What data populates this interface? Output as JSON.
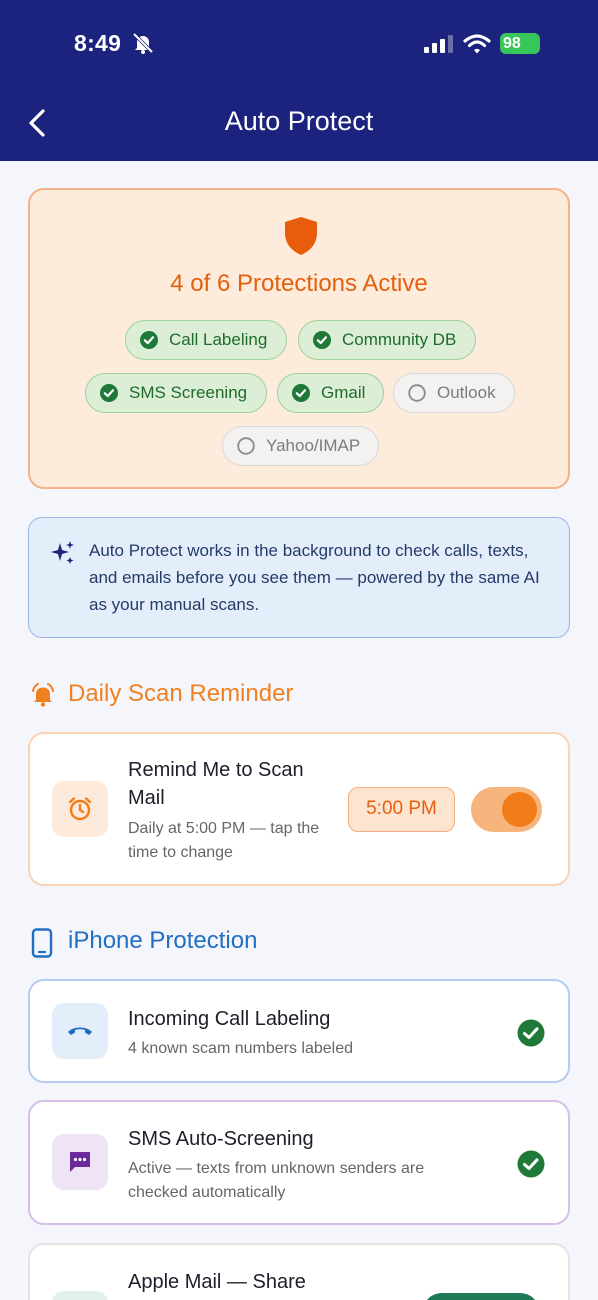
{
  "status_bar": {
    "time": "8:49",
    "battery": "98"
  },
  "header": {
    "title": "Auto Protect"
  },
  "protection_summary": {
    "title": "4 of 6 Protections Active",
    "active_count": 4,
    "total_count": 6,
    "chips": [
      {
        "label": "Call Labeling",
        "active": true
      },
      {
        "label": "Community DB",
        "active": true
      },
      {
        "label": "SMS Screening",
        "active": true
      },
      {
        "label": "Gmail",
        "active": true
      },
      {
        "label": "Outlook",
        "active": false
      },
      {
        "label": "Yahoo/IMAP",
        "active": false
      }
    ]
  },
  "info": {
    "text": "Auto Protect works in the background to check calls, texts, and emails before you see them — powered by the same AI as your manual scans."
  },
  "reminder_section": {
    "title": "Daily Scan Reminder",
    "card": {
      "title": "Remind Me to Scan Mail",
      "subtitle": "Daily at 5:00 PM — tap the time to change",
      "time": "5:00 PM",
      "enabled": true
    }
  },
  "iphone_section": {
    "title": "iPhone Protection",
    "items": [
      {
        "title": "Incoming Call Labeling",
        "subtitle": "4 known scam numbers labeled",
        "status": "active"
      },
      {
        "title": "SMS Auto-Screening",
        "subtitle": "Active — texts from unknown senders are checked automatically",
        "status": "active"
      },
      {
        "title": "Apple Mail — Share"
      }
    ]
  },
  "icons": [
    "bell-off-icon",
    "signal-icon",
    "wifi-icon",
    "battery-icon",
    "back-chevron-icon",
    "shield-icon",
    "check-circle-icon",
    "empty-circle-icon",
    "sparkle-icon",
    "bell-icon",
    "alarm-clock-icon",
    "phone-icon",
    "phone-handset-icon",
    "chat-bubble-icon"
  ],
  "colors": {
    "header": "#1b237e",
    "accent_orange": "#e4600e",
    "section_orange": "#f08020",
    "section_blue": "#1f6fc4",
    "success_green": "#1f7a3a",
    "chip_green_bg": "#dcefd6"
  }
}
